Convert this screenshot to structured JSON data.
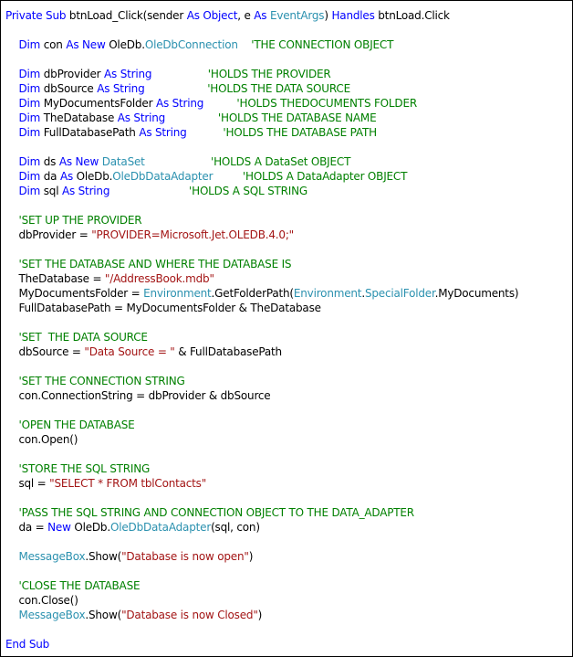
{
  "colors": {
    "keyword": "#0000ff",
    "type": "#2b91af",
    "string": "#a31515",
    "comment": "#008000",
    "plain": "#000000",
    "border": "#000000",
    "background": "#ffffff"
  },
  "code": {
    "language": "VB.NET",
    "lines": [
      [
        [
          "kw",
          "Private Sub "
        ],
        [
          "plain",
          "btnLoad_Click(sender "
        ],
        [
          "kw",
          "As Object"
        ],
        [
          "plain",
          ", e "
        ],
        [
          "kw",
          "As "
        ],
        [
          "type",
          "EventArgs"
        ],
        [
          "plain",
          ") "
        ],
        [
          "kw",
          "Handles "
        ],
        [
          "plain",
          "btnLoad.Click"
        ]
      ],
      [],
      [
        [
          "plain",
          "    "
        ],
        [
          "kw",
          "Dim "
        ],
        [
          "plain",
          "con "
        ],
        [
          "kw",
          "As New "
        ],
        [
          "plain",
          "OleDb."
        ],
        [
          "type",
          "OleDbConnection"
        ],
        [
          "plain",
          "    "
        ],
        [
          "comment",
          "'THE CONNECTION OBJECT"
        ]
      ],
      [],
      [
        [
          "plain",
          "    "
        ],
        [
          "kw",
          "Dim "
        ],
        [
          "plain",
          "dbProvider "
        ],
        [
          "kw",
          "As String"
        ],
        [
          "plain",
          "                 "
        ],
        [
          "comment",
          "'HOLDS THE PROVIDER"
        ]
      ],
      [
        [
          "plain",
          "    "
        ],
        [
          "kw",
          "Dim "
        ],
        [
          "plain",
          "dbSource "
        ],
        [
          "kw",
          "As String"
        ],
        [
          "plain",
          "                   "
        ],
        [
          "comment",
          "'HOLDS THE DATA SOURCE"
        ]
      ],
      [
        [
          "plain",
          "    "
        ],
        [
          "kw",
          "Dim "
        ],
        [
          "plain",
          "MyDocumentsFolder "
        ],
        [
          "kw",
          "As String"
        ],
        [
          "plain",
          "          "
        ],
        [
          "comment",
          "'HOLDS THEDOCUMENTS FOLDER"
        ]
      ],
      [
        [
          "plain",
          "    "
        ],
        [
          "kw",
          "Dim "
        ],
        [
          "plain",
          "TheDatabase "
        ],
        [
          "kw",
          "As String"
        ],
        [
          "plain",
          "                "
        ],
        [
          "comment",
          "'HOLDS THE DATABASE NAME"
        ]
      ],
      [
        [
          "plain",
          "    "
        ],
        [
          "kw",
          "Dim "
        ],
        [
          "plain",
          "FullDatabasePath "
        ],
        [
          "kw",
          "As String"
        ],
        [
          "plain",
          "           "
        ],
        [
          "comment",
          "'HOLDS THE DATABASE PATH"
        ]
      ],
      [],
      [
        [
          "plain",
          "    "
        ],
        [
          "kw",
          "Dim "
        ],
        [
          "plain",
          "ds "
        ],
        [
          "kw",
          "As New "
        ],
        [
          "type",
          "DataSet"
        ],
        [
          "plain",
          "                    "
        ],
        [
          "comment",
          "'HOLDS A DataSet OBJECT"
        ]
      ],
      [
        [
          "plain",
          "    "
        ],
        [
          "kw",
          "Dim "
        ],
        [
          "plain",
          "da "
        ],
        [
          "kw",
          "As "
        ],
        [
          "plain",
          "OleDb."
        ],
        [
          "type",
          "OleDbDataAdapter"
        ],
        [
          "plain",
          "         "
        ],
        [
          "comment",
          "'HOLDS A DataAdapter OBJECT"
        ]
      ],
      [
        [
          "plain",
          "    "
        ],
        [
          "kw",
          "Dim "
        ],
        [
          "plain",
          "sql "
        ],
        [
          "kw",
          "As String"
        ],
        [
          "plain",
          "                        "
        ],
        [
          "comment",
          "'HOLDS A SQL STRING"
        ]
      ],
      [],
      [
        [
          "plain",
          "    "
        ],
        [
          "comment",
          "'SET UP THE PROVIDER"
        ]
      ],
      [
        [
          "plain",
          "    dbProvider = "
        ],
        [
          "str",
          "\"PROVIDER=Microsoft.Jet.OLEDB.4.0;\""
        ]
      ],
      [],
      [
        [
          "plain",
          "    "
        ],
        [
          "comment",
          "'SET THE DATABASE AND WHERE THE DATABASE IS"
        ]
      ],
      [
        [
          "plain",
          "    TheDatabase = "
        ],
        [
          "str",
          "\"/AddressBook.mdb\""
        ]
      ],
      [
        [
          "plain",
          "    MyDocumentsFolder = "
        ],
        [
          "type",
          "Environment"
        ],
        [
          "plain",
          ".GetFolderPath("
        ],
        [
          "type",
          "Environment"
        ],
        [
          "plain",
          "."
        ],
        [
          "type",
          "SpecialFolder"
        ],
        [
          "plain",
          ".MyDocuments)"
        ]
      ],
      [
        [
          "plain",
          "    FullDatabasePath = MyDocumentsFolder & TheDatabase"
        ]
      ],
      [],
      [
        [
          "plain",
          "    "
        ],
        [
          "comment",
          "'SET  THE DATA SOURCE"
        ]
      ],
      [
        [
          "plain",
          "    dbSource = "
        ],
        [
          "str",
          "\"Data Source = \""
        ],
        [
          "plain",
          " & FullDatabasePath"
        ]
      ],
      [],
      [
        [
          "plain",
          "    "
        ],
        [
          "comment",
          "'SET THE CONNECTION STRING"
        ]
      ],
      [
        [
          "plain",
          "    con.ConnectionString = dbProvider & dbSource"
        ]
      ],
      [],
      [
        [
          "plain",
          "    "
        ],
        [
          "comment",
          "'OPEN THE DATABASE"
        ]
      ],
      [
        [
          "plain",
          "    con.Open()"
        ]
      ],
      [],
      [
        [
          "plain",
          "    "
        ],
        [
          "comment",
          "'STORE THE SQL STRING"
        ]
      ],
      [
        [
          "plain",
          "    sql = "
        ],
        [
          "str",
          "\"SELECT * FROM tblContacts\""
        ]
      ],
      [],
      [
        [
          "plain",
          "    "
        ],
        [
          "comment",
          "'PASS THE SQL STRING AND CONNECTION OBJECT TO THE DATA_ADAPTER"
        ]
      ],
      [
        [
          "plain",
          "    da = "
        ],
        [
          "kw",
          "New "
        ],
        [
          "plain",
          "OleDb."
        ],
        [
          "type",
          "OleDbDataAdapter"
        ],
        [
          "plain",
          "(sql, con)"
        ]
      ],
      [],
      [
        [
          "plain",
          "    "
        ],
        [
          "type",
          "MessageBox"
        ],
        [
          "plain",
          ".Show("
        ],
        [
          "str",
          "\"Database is now open\""
        ],
        [
          "plain",
          ")"
        ]
      ],
      [],
      [
        [
          "plain",
          "    "
        ],
        [
          "comment",
          "'CLOSE THE DATABASE"
        ]
      ],
      [
        [
          "plain",
          "    con.Close()"
        ]
      ],
      [
        [
          "plain",
          "    "
        ],
        [
          "type",
          "MessageBox"
        ],
        [
          "plain",
          ".Show("
        ],
        [
          "str",
          "\"Database is now Closed\""
        ],
        [
          "plain",
          ")"
        ]
      ],
      [],
      [
        [
          "kw",
          "End Sub"
        ]
      ]
    ]
  }
}
